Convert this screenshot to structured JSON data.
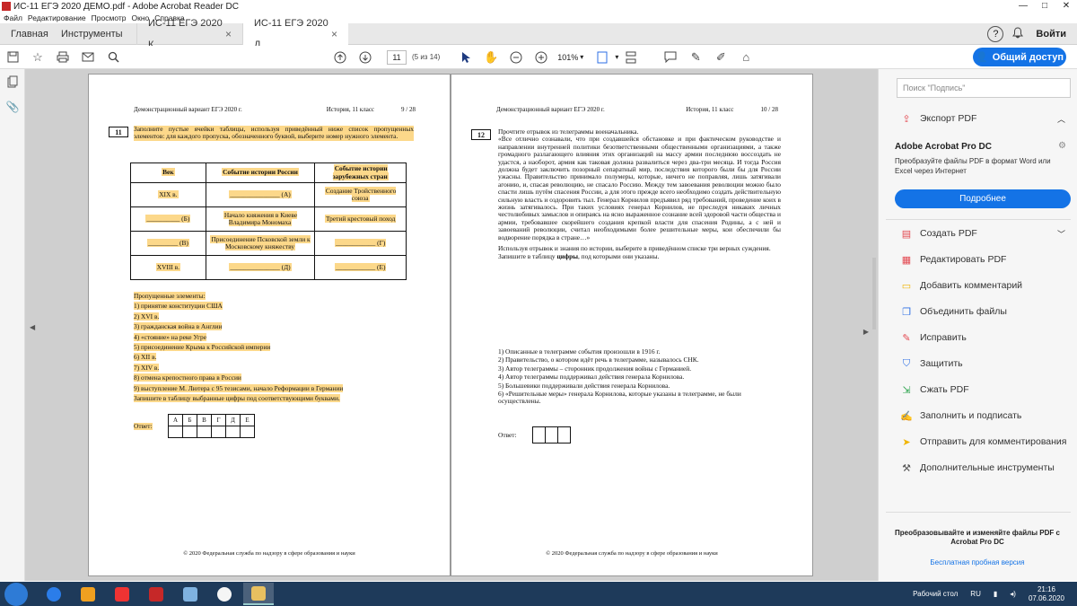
{
  "window": {
    "title": "ИС-11 ЕГЭ 2020 ДЕМО.pdf - Adobe Acrobat Reader DC",
    "minimize": "—",
    "maximize": "□",
    "close": "✕"
  },
  "menu": [
    "Файл",
    "Редактирование",
    "Просмотр",
    "Окно",
    "Справка"
  ],
  "tabs": {
    "home": "Главная",
    "tools": "Инструменты",
    "docs": [
      {
        "label": "ИС-11 ЕГЭ 2020 К...",
        "active": false
      },
      {
        "label": "ИС-11 ЕГЭ 2020 Д...",
        "active": true
      }
    ],
    "close_glyph": "×",
    "help": "?",
    "login": "Войти"
  },
  "toolbar": {
    "page_current": "11",
    "page_count": "(5 из 14)",
    "zoom": "101%",
    "share_button": "Общий доступ"
  },
  "page_left": {
    "header_left": "Демонстрационный вариант ЕГЭ 2020 г.",
    "header_mid": "История, 11 класс",
    "header_right": "9 / 28",
    "qnum": "11",
    "instruction": "Заполните пустые ячейки таблицы, используя приведённый ниже список пропущенных элементов: для каждого пропуска, обозначенного буквой, выберите номер нужного элемента.",
    "table": {
      "headers": [
        "Век",
        "Событие истории России",
        "Событие истории зарубежных стран"
      ],
      "rows": [
        [
          "XIX в.",
          "_______________ (А)",
          "Создание Тройственного союза"
        ],
        [
          "__________ (Б)",
          "Начало княжения в Киеве Владимира Мономаха",
          "Третий крестовый поход"
        ],
        [
          "_________ (В)",
          "Присоединение Псковской земли к Московскому княжеству",
          "____________ (Г)"
        ],
        [
          "XVIII в.",
          "_______________ (Д)",
          "____________ (Е)"
        ]
      ]
    },
    "missing_title": "Пропущенные элементы:",
    "missing": [
      "1)   принятие конституции США",
      "2)   XVI в.",
      "3)   гражданская война в Англии",
      "4)   «стояние» на реке Угре",
      "5)   присоединение Крыма к Российской империи",
      "6)   XII в.",
      "7)   XIV в.",
      "8)   отмена крепостного права в России",
      "9)   выступление М. Лютера с 95 тезисами, начало Реформации в Германии"
    ],
    "write_instruction": "Запишите в таблицу выбранные цифры под соответствующими буквами.",
    "answer_label": "Ответ:",
    "answer_letters": [
      "А",
      "Б",
      "В",
      "Г",
      "Д",
      "Е"
    ],
    "footer": "© 2020 Федеральная служба по надзору в сфере образования и науки"
  },
  "page_right": {
    "header_left": "Демонстрационный вариант ЕГЭ 2020 г.",
    "header_mid": "История, 11 класс",
    "header_right": "10 / 28",
    "qnum": "12",
    "intro": "Прочтите отрывок из телеграммы военачальника.",
    "quote": "«Все отлично сознавали, что при создавшейся обстановке и при фактическом руководстве и направлении внутренней политики безответственными общественными организациями, а также громадного разлагающего влияния этих организаций на массу армии последнюю воссоздать не удастся, а наоборот, армия как таковая должна развалиться через два-три месяца. И тогда Россия должна будет заключить позорный сепаратный мир, последствия которого были бы для России ужасны. Правительство принимало полумеры, которые, ничего не поправляя, лишь затягивали агонию, и, спасая революцию, не спасало Россию. Между тем завоевания революции можно было спасти лишь путём спасения России, а для этого прежде всего необходимо создать действительную сильную власть и оздоровить тыл. Генерал Корнилов предъявил ряд требований, проведение коих в жизнь затягивалось. При таких условиях генерал Корнилов, не преследуя никаких личных честолюбивых замыслов и опираясь на ясно выраженное сознание всей здоровой части общества и армии, требовавшее скорейшего создания крепкой власти для спасения Родины, а с ней и завоеваний революции, считал необходимыми более решительные меры, кои обеспечили бы водворение порядка в стране…»",
    "task_1": "Используя отрывок и знания по истории, выберите в приведённом списке три верных суждения.",
    "task_2_prefix": "Запишите в таблицу ",
    "task_2_bold": "цифры",
    "task_2_suffix": ", под которыми они указаны.",
    "options": [
      "1)   Описанные в телеграмме события произошли в 1916 г.",
      "2)   Правительство, о котором идёт речь в телеграмме, называлось СНК.",
      "3)   Автор телеграммы – сторонник продолжения войны с Германией.",
      "4)   Автор телеграммы поддерживал действия генерала Корнилова.",
      "5)   Большевики поддерживали действия генерала Корнилова.",
      "6)   «Решительные меры» генерала Корнилова, которые указаны в телеграмме, не были осуществлены."
    ],
    "answer_label": "Ответ:",
    "footer": "© 2020 Федеральная служба по надзору в сфере образования и науки"
  },
  "right_panel": {
    "search_placeholder": "Поиск \"Подпись\"",
    "export_pdf": "Экспорт PDF",
    "promo_title": "Adobe Acrobat Pro DC",
    "promo_text": "Преобразуйте файлы PDF в формат Word или Excel через Интернет",
    "promo_button": "Подробнее",
    "tools": [
      {
        "label": "Создать PDF",
        "icon": "create-pdf-icon",
        "color": "#e34850",
        "chevron": true
      },
      {
        "label": "Редактировать PDF",
        "icon": "edit-pdf-icon",
        "color": "#e34850",
        "chevron": false
      },
      {
        "label": "Добавить комментарий",
        "icon": "comment-icon",
        "color": "#f0b400",
        "chevron": false
      },
      {
        "label": "Объединить файлы",
        "icon": "combine-icon",
        "color": "#2d6fe4",
        "chevron": false
      },
      {
        "label": "Исправить",
        "icon": "redact-icon",
        "color": "#e34850",
        "chevron": false
      },
      {
        "label": "Защитить",
        "icon": "protect-icon",
        "color": "#2d6fe4",
        "chevron": false
      },
      {
        "label": "Сжать PDF",
        "icon": "compress-icon",
        "color": "#2da44e",
        "chevron": false
      },
      {
        "label": "Заполнить и подписать",
        "icon": "sign-icon",
        "color": "#8a4bd1",
        "chevron": false
      },
      {
        "label": "Отправить для комментирования",
        "icon": "send-icon",
        "color": "#f0b400",
        "chevron": false
      },
      {
        "label": "Дополнительные инструменты",
        "icon": "more-tools-icon",
        "color": "#555555",
        "chevron": false
      }
    ],
    "bottom_text": "Преобразовывайте и изменяйте файлы PDF с Acrobat Pro DC",
    "trial_link": "Бесплатная пробная версия"
  },
  "taskbar": {
    "desktop": "Рабочий стол",
    "lang": "RU",
    "time": "21:16",
    "date": "07.06.2020"
  },
  "colors": {
    "accent": "#1473e6",
    "highlight": "#fcd88a",
    "taskbar": "#1e3a5a"
  }
}
